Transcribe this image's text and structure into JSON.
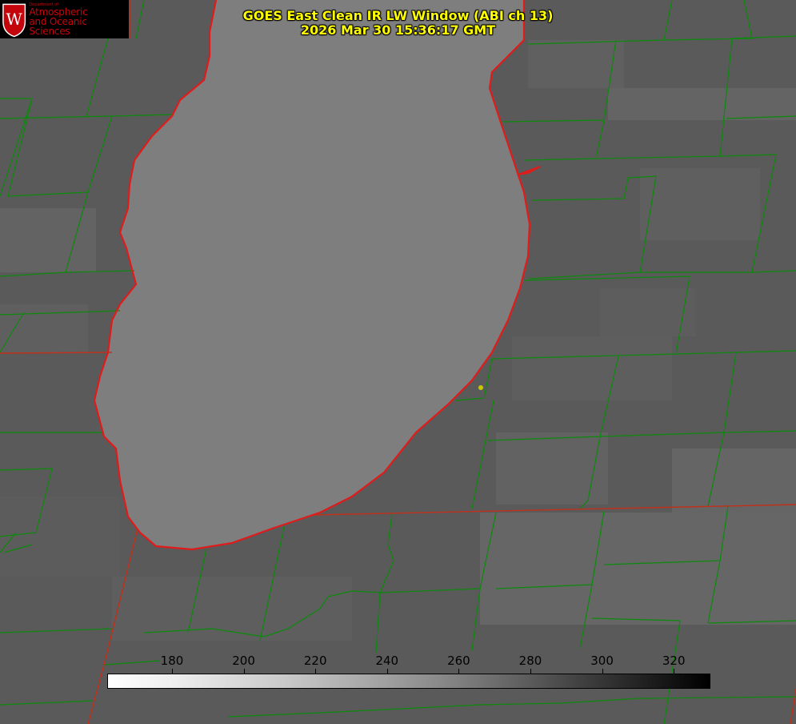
{
  "title": {
    "line1": "GOES East Clean IR LW Window (ABI ch 13)",
    "line2": "2026 Mar 30 15:36:17 GMT"
  },
  "logo": {
    "dept": "Department of",
    "line1": "Atmospheric",
    "line2": "and Oceanic Sciences",
    "icon": "uw-crest-icon"
  },
  "colorbar": {
    "ticks": [
      "180",
      "200",
      "220",
      "240",
      "260",
      "280",
      "300",
      "320"
    ],
    "colors": [
      "#ffffff",
      "#000000"
    ]
  },
  "map": {
    "colors": {
      "lake": "#7e7e7e",
      "land": "#5a5a5a",
      "county_lines": "#0b8a0b",
      "state_lines": "#c0301a",
      "shoreline": "#e01b1b",
      "marker": "#c8c800"
    }
  }
}
